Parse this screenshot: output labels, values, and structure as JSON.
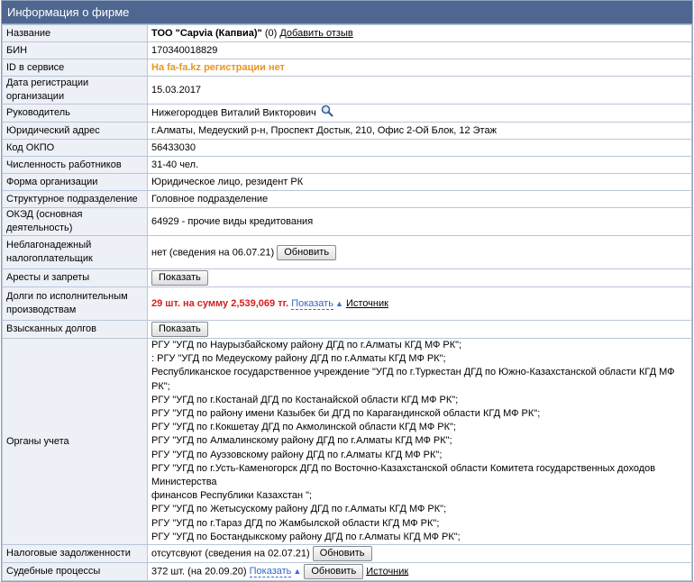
{
  "header": {
    "title": "Информация о фирме"
  },
  "name": {
    "label": "Название",
    "company": "ТОО \"Capvia (Капвиа)\"",
    "reviews_count": "(0)",
    "add_review": "Добавить отзыв"
  },
  "bin": {
    "label": "БИН",
    "value": "170340018829"
  },
  "service_id": {
    "label": "ID в сервисе",
    "value": "На fa-fa.kz регистрации нет"
  },
  "reg_date": {
    "label": "Дата регистрации организации",
    "value": "15.03.2017"
  },
  "director": {
    "label": "Руководитель",
    "value": "Нижегородцев Виталий Викторович",
    "icon": "search-icon"
  },
  "address": {
    "label": "Юридический адрес",
    "value": "г.Алматы, Медеуский р-н, Проспект Достык, 210, Офис 2-Ой Блок, 12 Этаж"
  },
  "okpo": {
    "label": "Код ОКПО",
    "value": "56433030"
  },
  "employees": {
    "label": "Численность работников",
    "value": "31-40 чел."
  },
  "org_form": {
    "label": "Форма организации",
    "value": "Юридическое лицо, резидент РК"
  },
  "subdivision": {
    "label": "Структурное подразделение",
    "value": "Головное подразделение"
  },
  "oked": {
    "label": "ОКЭД (основная деятельность)",
    "value": "64929 - прочие виды кредитования"
  },
  "unreliable": {
    "label": "Неблагонадежный налогоплательщик",
    "value": "нет (сведения на 06.07.21)",
    "button": "Обновить"
  },
  "arrests": {
    "label": "Аресты и запреты",
    "button": "Показать"
  },
  "enforcement_debts": {
    "label": "Долги по исполнительным производствам",
    "value": "29 шт. на сумму 2,539,069 тг.",
    "show": "Показать",
    "arrow": "▲",
    "source": "Источник"
  },
  "collected_debts": {
    "label": "Взысканных долгов",
    "button": "Показать"
  },
  "authorities": {
    "label": "Органы учета",
    "items": [
      "РГУ \"УГД по Наурызбайскому району ДГД по г.Алматы КГД МФ РК\";",
      ": РГУ \"УГД по Медеускому району ДГД по г.Алматы КГД МФ РК\";",
      "Республиканское государственное учреждение \"УГД по г.Туркестан ДГД по Южно-Казахстанской области КГД МФ РК\";",
      "РГУ \"УГД по г.Костанай ДГД по Костанайской области КГД МФ РК\";",
      "РГУ \"УГД по району имени Казыбек би ДГД по Карагандинской области КГД МФ РК\";",
      "РГУ \"УГД по г.Кокшетау ДГД по Акмолинской области КГД МФ РК\";",
      "РГУ \"УГД по Алмалинскому району ДГД по г.Алматы КГД МФ РК\";",
      "РГУ \"УГД по Ауэзовскому району ДГД по г.Алматы КГД МФ РК\";",
      "РГУ \"УГД по г.Усть-Каменогорск ДГД по Восточно-Казахстанской области Комитета государственных доходов Министерства",
      "финансов Республики Казахстан \";",
      "РГУ \"УГД по Жетысускому району ДГД по г.Алматы КГД МФ РК\";",
      "РГУ \"УГД по г.Тараз ДГД по Жамбылской области КГД МФ РК\";",
      "РГУ \"УГД по Бостандыкскому району ДГД по г.Алматы КГД МФ РК\";"
    ]
  },
  "tax_debts": {
    "label": "Налоговые задолженности",
    "value": "отсутсвуют (сведения на 02.07.21)",
    "button": "Обновить"
  },
  "court": {
    "label": "Судебные процессы",
    "value": "372 шт. (на 20.09.20)",
    "show": "Показать",
    "arrow": "▲",
    "button": "Обновить",
    "source": "Источник"
  }
}
